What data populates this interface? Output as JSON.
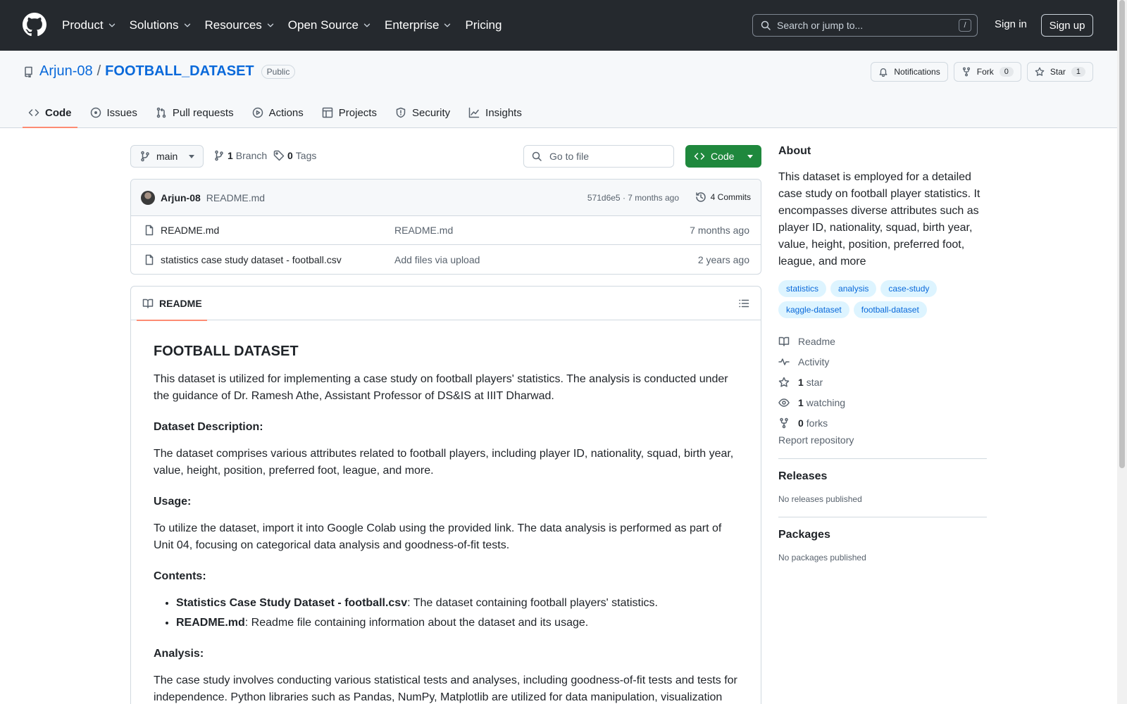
{
  "header": {
    "nav": [
      {
        "label": "Product",
        "dropdown": true
      },
      {
        "label": "Solutions",
        "dropdown": true
      },
      {
        "label": "Resources",
        "dropdown": true
      },
      {
        "label": "Open Source",
        "dropdown": true
      },
      {
        "label": "Enterprise",
        "dropdown": true
      },
      {
        "label": "Pricing",
        "dropdown": false
      }
    ],
    "search_placeholder": "Search or jump to...",
    "search_shortcut": "/",
    "sign_in": "Sign in",
    "sign_up": "Sign up"
  },
  "repo": {
    "owner": "Arjun-08",
    "separator": "/",
    "name": "FOOTBALL_DATASET",
    "visibility": "Public",
    "notifications_label": "Notifications",
    "fork_label": "Fork",
    "fork_count": "0",
    "star_label": "Star",
    "star_count": "1"
  },
  "tabs": [
    {
      "label": "Code",
      "icon": "code-icon",
      "active": true
    },
    {
      "label": "Issues",
      "icon": "issue-icon"
    },
    {
      "label": "Pull requests",
      "icon": "pull-request-icon"
    },
    {
      "label": "Actions",
      "icon": "play-icon"
    },
    {
      "label": "Projects",
      "icon": "table-icon"
    },
    {
      "label": "Security",
      "icon": "shield-icon"
    },
    {
      "label": "Insights",
      "icon": "graph-icon"
    }
  ],
  "toolbar": {
    "branch": "main",
    "branch_count": "1",
    "branch_label": "Branch",
    "tag_count": "0",
    "tag_label": "Tags",
    "goto_placeholder": "Go to file",
    "code_button": "Code"
  },
  "latest_commit": {
    "author": "Arjun-08",
    "message": "README.md",
    "meta": "571d6e5 · 7 months ago",
    "commits": "4 Commits"
  },
  "files": [
    {
      "name": "README.md",
      "commit": "README.md",
      "time": "7 months ago"
    },
    {
      "name": "statistics case study dataset - football.csv",
      "commit": "Add files via upload",
      "time": "2 years ago"
    }
  ],
  "readme": {
    "tab_label": "README",
    "title": "FOOTBALL DATASET",
    "intro": "This dataset is utilized for implementing a case study on football players' statistics. The analysis is conducted under the guidance of Dr. Ramesh Athe, Assistant Professor of DS&IS at IIIT Dharwad.",
    "desc_heading": "Dataset Description:",
    "desc_text": "The dataset comprises various attributes related to football players, including player ID, nationality, squad, birth year, value, height, position, preferred foot, league, and more.",
    "usage_heading": "Usage:",
    "usage_text": "To utilize the dataset, import it into Google Colab using the provided link. The data analysis is performed as part of Unit 04, focusing on categorical data analysis and goodness-of-fit tests.",
    "contents_heading": "Contents:",
    "contents": [
      {
        "bold": "Statistics Case Study Dataset - football.csv",
        "text": ": The dataset containing football players' statistics."
      },
      {
        "bold": "README.md",
        "text": ": Readme file containing information about the dataset and its usage."
      }
    ],
    "analysis_heading": "Analysis:",
    "analysis_text": "The case study involves conducting various statistical tests and analyses, including goodness-of-fit tests and tests for independence. Python libraries such as Pandas, NumPy, Matplotlib are utilized for data manipulation, visualization"
  },
  "about": {
    "heading": "About",
    "text": "This dataset is employed for a detailed case study on football player statistics. It encompasses diverse attributes such as player ID, nationality, squad, birth year, value, height, position, preferred foot, league, and more",
    "topics": [
      "statistics",
      "analysis",
      "case-study",
      "kaggle-dataset",
      "football-dataset"
    ],
    "readme": "Readme",
    "activity": "Activity",
    "stars_count": "1",
    "stars_label": "star",
    "watching_count": "1",
    "watching_label": "watching",
    "forks_count": "0",
    "forks_label": "forks",
    "report": "Report repository"
  },
  "releases": {
    "heading": "Releases",
    "empty": "No releases published"
  },
  "packages": {
    "heading": "Packages",
    "empty": "No packages published"
  }
}
